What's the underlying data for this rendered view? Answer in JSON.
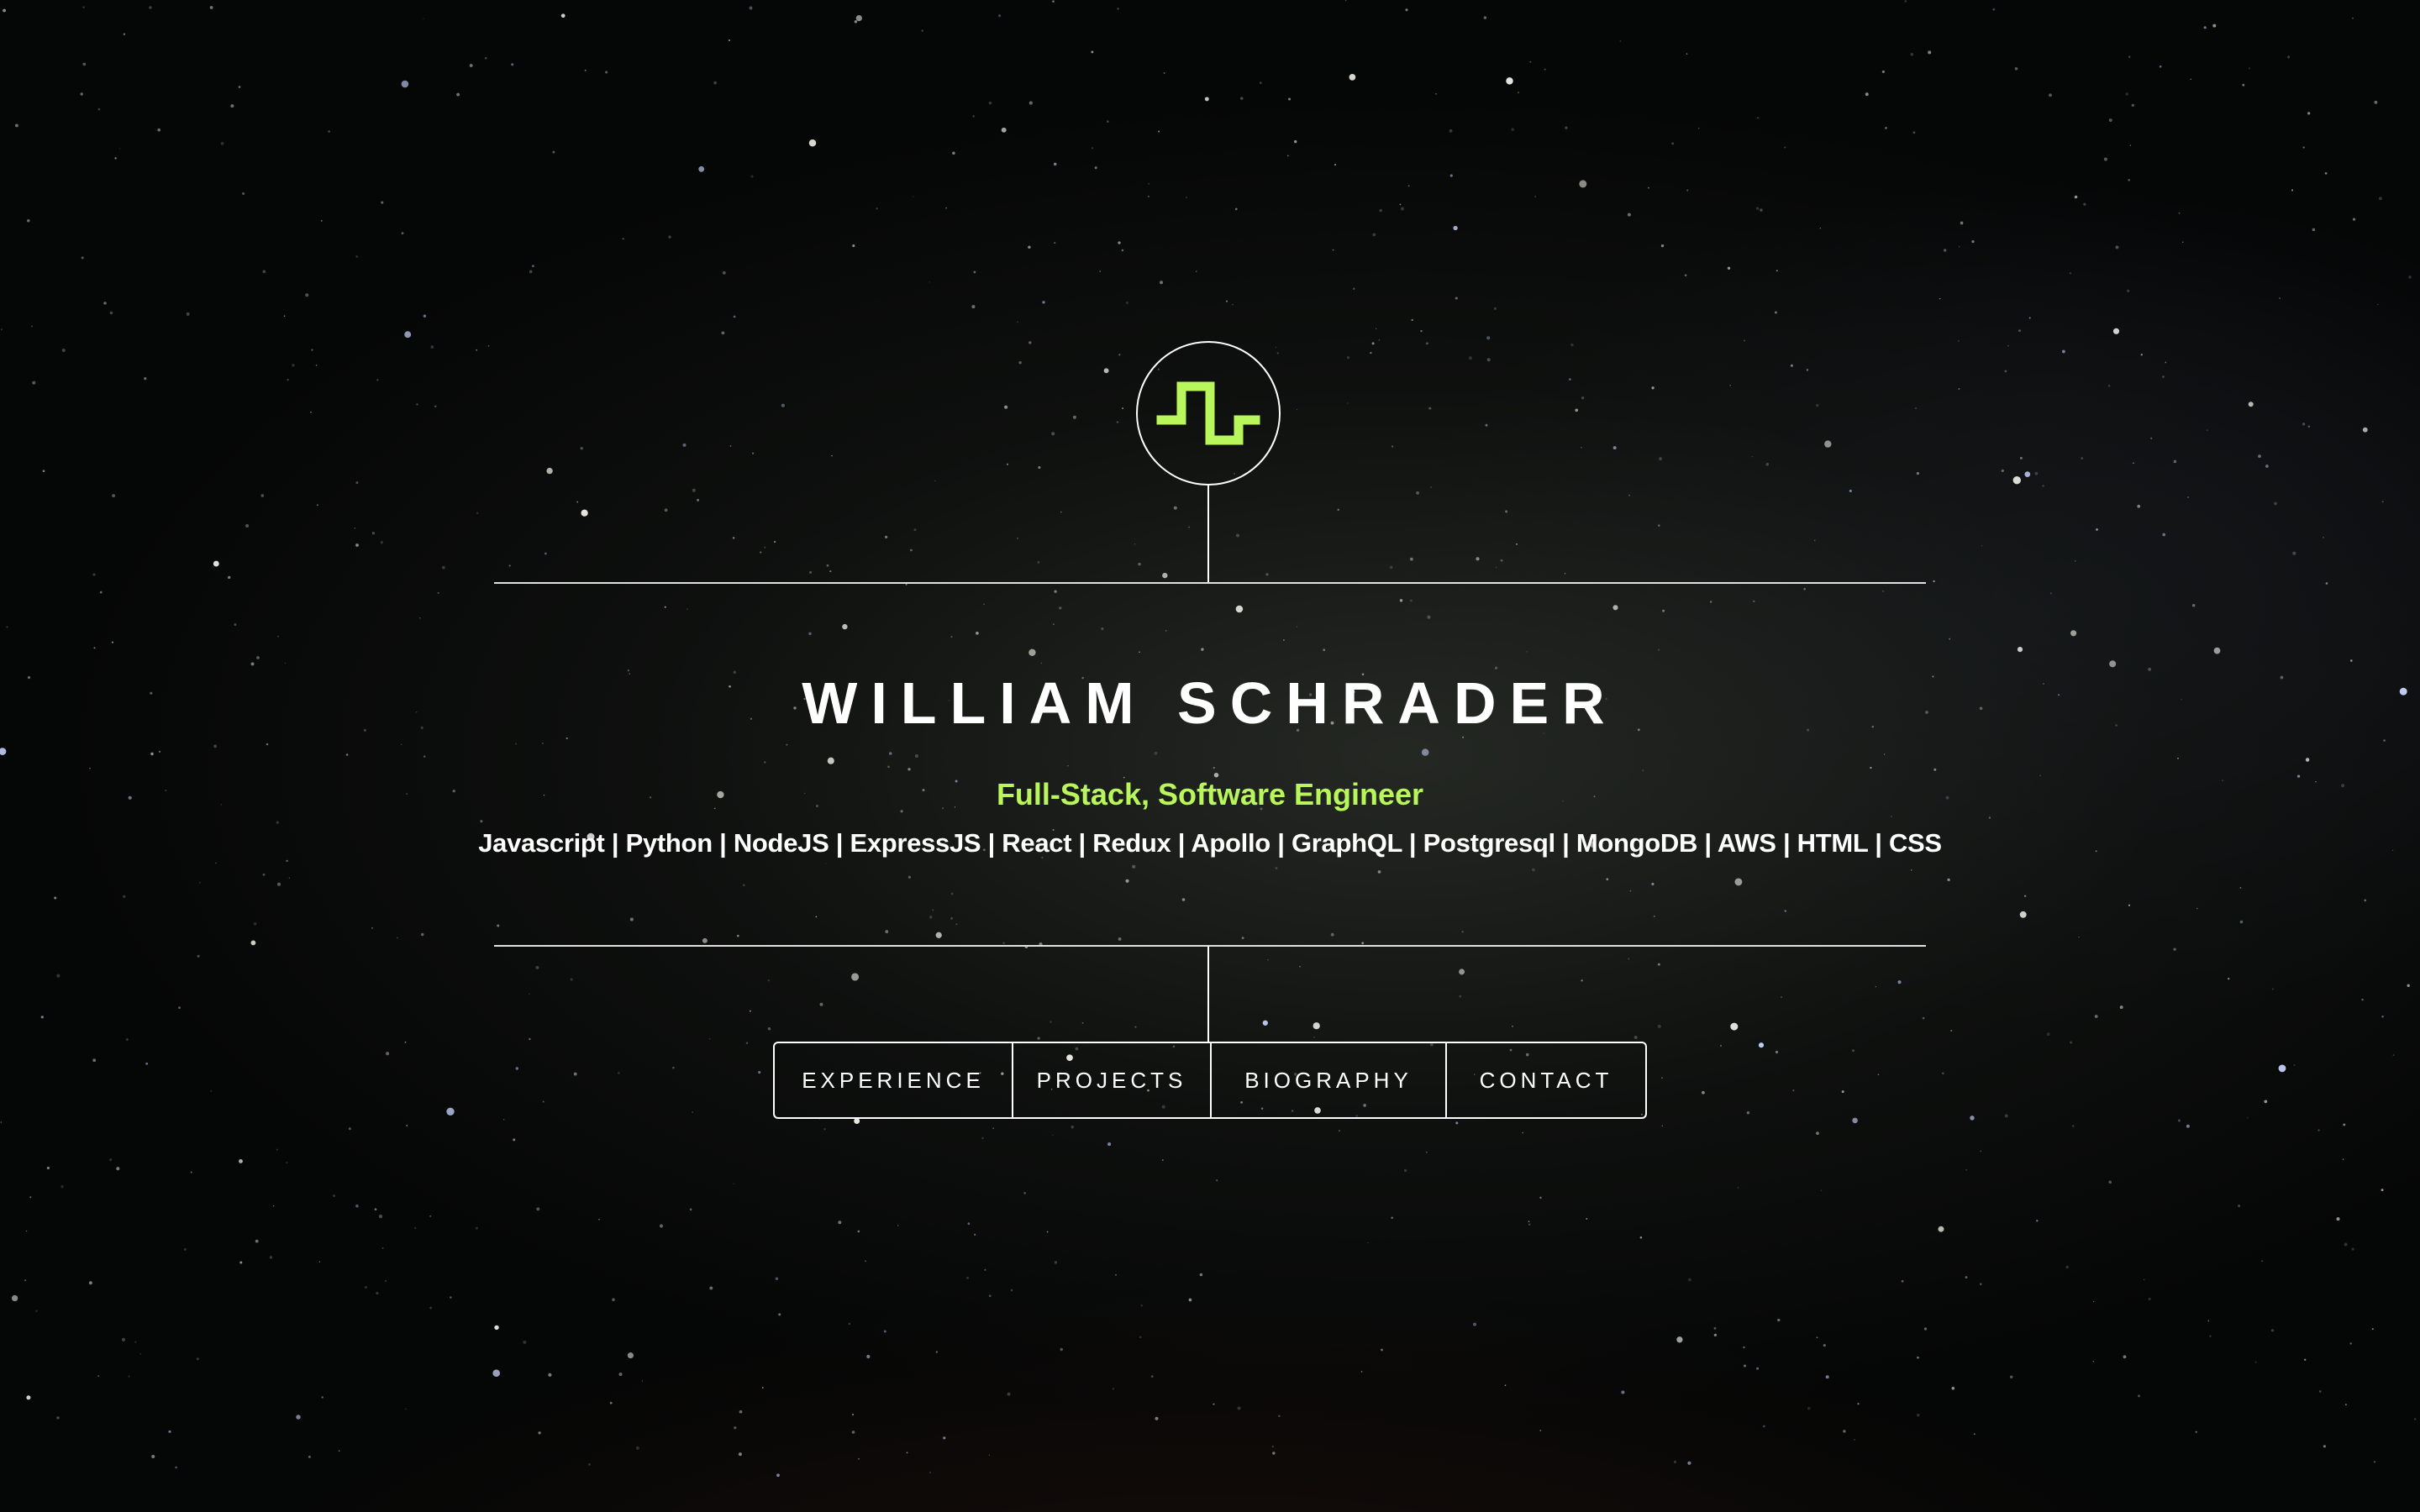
{
  "hero": {
    "name": "WILLIAM SCHRADER",
    "role": "Full-Stack, Software Engineer",
    "skills": "Javascript | Python | NodeJS | ExpressJS | React | Redux | Apollo | GraphQL | Postgresql | MongoDB | AWS | HTML | CSS"
  },
  "logo": {
    "icon": "square-wave-icon",
    "color": "#b9f65b"
  },
  "nav": {
    "items": [
      {
        "label": "EXPERIENCE"
      },
      {
        "label": "PROJECTS"
      },
      {
        "label": "BIOGRAPHY"
      },
      {
        "label": "CONTACT"
      }
    ]
  },
  "colors": {
    "accent": "#b9f65b",
    "text": "#ffffff",
    "background": "#050606"
  }
}
